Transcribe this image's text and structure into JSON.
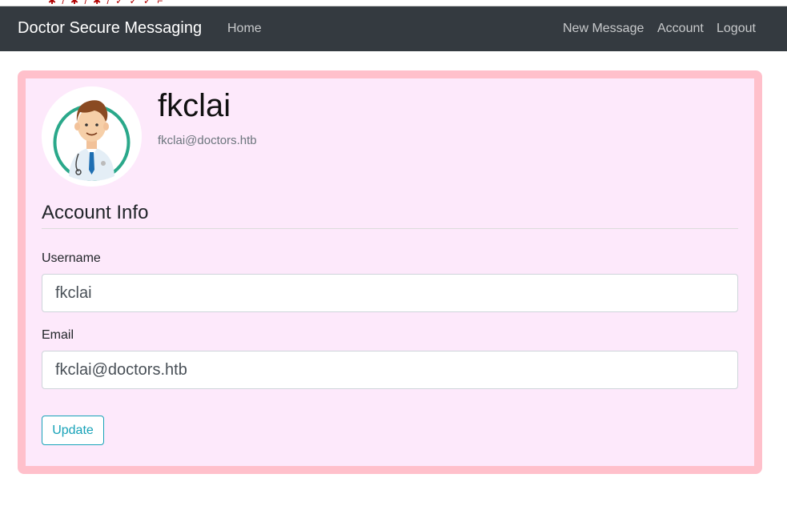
{
  "navbar": {
    "brand": "Doctor Secure Messaging",
    "home": "Home",
    "new_message": "New Message",
    "account": "Account",
    "logout": "Logout",
    "background": "#343a40"
  },
  "profile": {
    "name": "fkclai",
    "email": "fkclai@doctors.htb",
    "avatar_icon": "doctor-avatar-icon"
  },
  "account_info": {
    "title": "Account Info",
    "username_label": "Username",
    "username_value": "fkclai",
    "email_label": "Email",
    "email_value": "fkclai@doctors.htb",
    "update_label": "Update"
  },
  "colors": {
    "card_border": "#ffc0cb",
    "card_background": "#fde9fb",
    "button_accent": "#17a2b8"
  }
}
